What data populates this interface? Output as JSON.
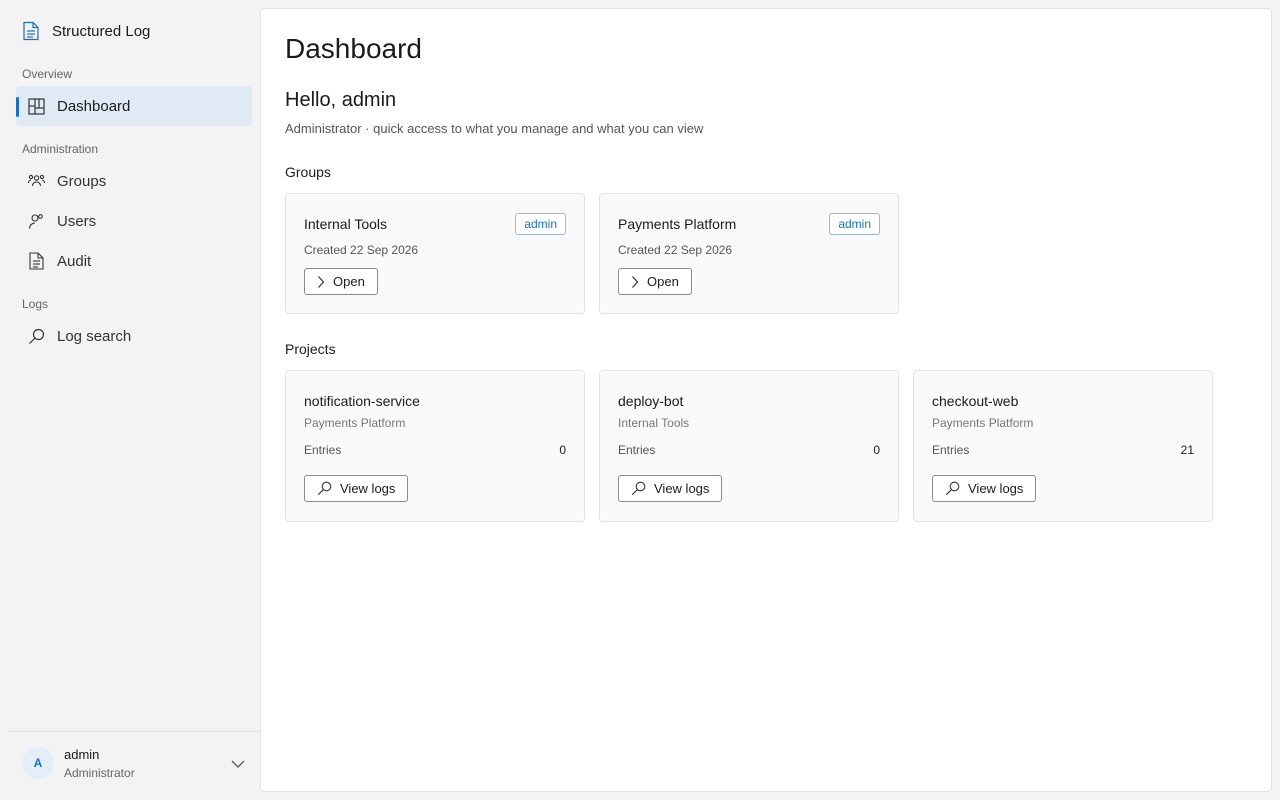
{
  "app": {
    "title": "Structured Log"
  },
  "sidebar": {
    "sections": [
      {
        "label": "Overview"
      },
      {
        "label": "Administration"
      },
      {
        "label": "Logs"
      }
    ],
    "items": [
      {
        "label": "Dashboard",
        "icon": "dashboard-icon",
        "active": true
      },
      {
        "label": "Groups",
        "icon": "groups-icon"
      },
      {
        "label": "Users",
        "icon": "users-icon"
      },
      {
        "label": "Audit",
        "icon": "document-icon"
      },
      {
        "label": "Log search",
        "icon": "search-icon"
      }
    ],
    "user": {
      "initial": "A",
      "name": "admin",
      "role": "Administrator"
    }
  },
  "main": {
    "title": "Dashboard",
    "greeting": "Hello, admin",
    "subtext": "Administrator · quick access to what you manage and what you can view",
    "groups_heading": "Groups",
    "groups": [
      {
        "name": "Internal Tools",
        "badge": "admin",
        "created": "Created 22 Sep 2026",
        "button": "Open"
      },
      {
        "name": "Payments Platform",
        "badge": "admin",
        "created": "Created 22 Sep 2026",
        "button": "Open"
      }
    ],
    "projects_heading": "Projects",
    "projects": [
      {
        "name": "notification-service",
        "group": "Payments Platform",
        "entries_label": "Entries",
        "entries": "0",
        "button": "View logs"
      },
      {
        "name": "deploy-bot",
        "group": "Internal Tools",
        "entries_label": "Entries",
        "entries": "0",
        "button": "View logs"
      },
      {
        "name": "checkout-web",
        "group": "Payments Platform",
        "entries_label": "Entries",
        "entries": "21",
        "button": "View logs"
      }
    ]
  },
  "colors": {
    "accent": "#1a6fc3",
    "active_bg": "#dfeaf5",
    "sidebar_bg": "#f3f3f3",
    "card_bg": "#fafafa"
  }
}
